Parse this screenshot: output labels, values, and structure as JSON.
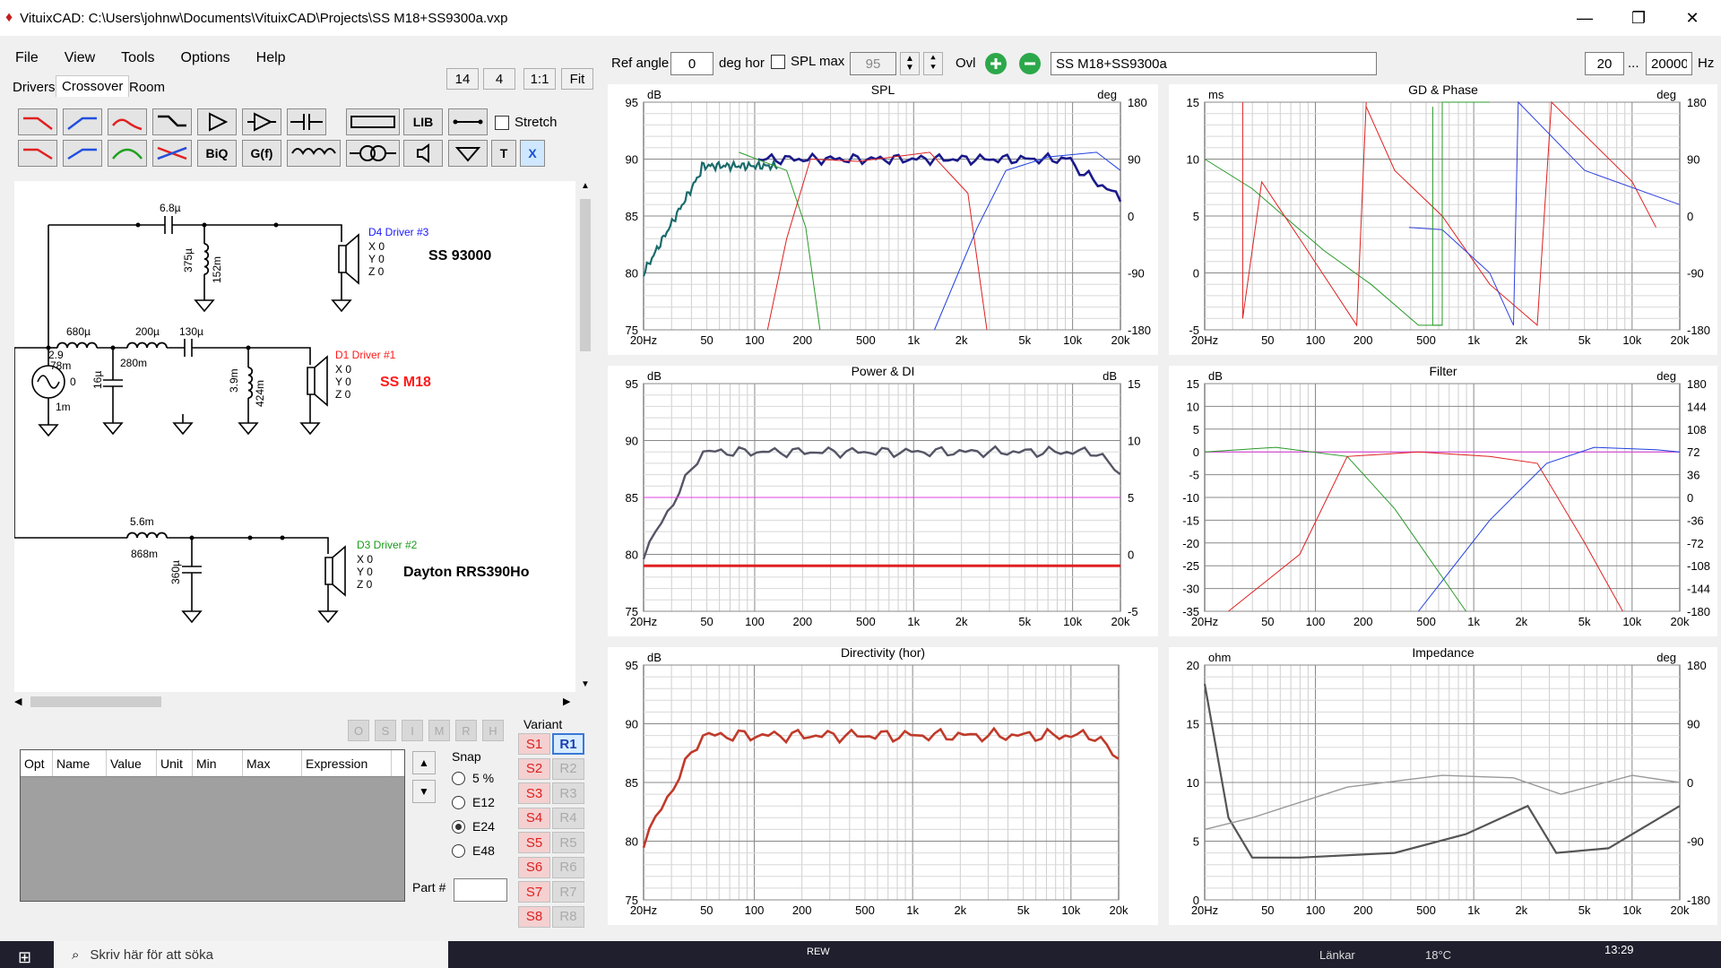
{
  "window": {
    "title": "VituixCAD: C:\\Users\\johnw\\Documents\\VituixCAD\\Projects\\SS M18+SS9300a.vxp"
  },
  "menu": [
    "File",
    "View",
    "Tools",
    "Options",
    "Help"
  ],
  "tabs": [
    "Drivers",
    "Crossover",
    "Room"
  ],
  "zoom_buttons": [
    "14",
    "4",
    "1:1",
    "Fit"
  ],
  "toolbar": {
    "lib": "LIB",
    "biq": "BiQ",
    "gf": "G(f)",
    "t": "T",
    "x": "X",
    "stretch": "Stretch"
  },
  "topbar": {
    "ref_angle_label": "Ref angle",
    "ref_angle": "0",
    "deg_hor": "deg hor",
    "spl_max_label": "SPL max",
    "spl_max": "95",
    "ovl": "Ovl",
    "project": "SS M18+SS9300a",
    "f_min": "20",
    "dots": "...",
    "f_max": "20000",
    "hz": "Hz"
  },
  "schematic": {
    "drivers": [
      {
        "id": "D4 Driver #3",
        "name": "SS 93000",
        "color": "#1a1aff",
        "x": "X 0",
        "y": "Y 0",
        "z": "Z 0"
      },
      {
        "id": "D1 Driver #1",
        "name": "SS M18",
        "color": "#ff1a1a",
        "x": "X 0",
        "y": "Y 0",
        "z": "Z 0"
      },
      {
        "id": "D3 Driver #2",
        "name": "Dayton RRS390Ho",
        "color": "#1a9a1a",
        "x": "X 0",
        "y": "Y 0",
        "z": "Z 0"
      }
    ],
    "labels": {
      "c1": "6.8µ",
      "l1": "375µ",
      "r1": "152m",
      "l2": "680µ",
      "l3": "200µ",
      "r3": "280m",
      "c2": "130µ",
      "l4": "3.9m",
      "r4": "424m",
      "r2": "78m",
      "c3": "16µ",
      "rs": "2.9",
      "gen0": "0",
      "gen1": "1m",
      "l5": "5.6m",
      "r5": "868m",
      "c4": "360µ"
    }
  },
  "param_table": {
    "headers": [
      "Opt",
      "Name",
      "Value",
      "Unit",
      "Min",
      "Max",
      "Expression"
    ]
  },
  "osir": [
    "O",
    "S",
    "I",
    "M",
    "R",
    "H"
  ],
  "snap": {
    "label": "Snap",
    "options": [
      "5 %",
      "E12",
      "E24",
      "E48"
    ],
    "selected": "E24"
  },
  "part_label": "Part #",
  "variant": {
    "label": "Variant",
    "s": [
      "S1",
      "S2",
      "S3",
      "S4",
      "S5",
      "S6",
      "S7",
      "S8"
    ],
    "r": [
      "R1",
      "R2",
      "R3",
      "R4",
      "R5",
      "R6",
      "R7",
      "R8"
    ]
  },
  "charts": {
    "spl": {
      "title": "SPL",
      "yunit": "dB",
      "y2unit": "deg",
      "yticks": [
        "95",
        "90",
        "85",
        "80",
        "75"
      ],
      "y2ticks": [
        "180",
        "90",
        "0",
        "-90",
        "-180"
      ]
    },
    "gd": {
      "title": "GD & Phase",
      "yunit": "ms",
      "y2unit": "deg",
      "yticks": [
        "15",
        "10",
        "5",
        "0",
        "-5"
      ],
      "y2ticks": [
        "180",
        "90",
        "0",
        "-90",
        "-180"
      ]
    },
    "power": {
      "title": "Power & DI",
      "yunit": "dB",
      "y2unit": "dB",
      "yticks": [
        "95",
        "90",
        "85",
        "80",
        "75"
      ],
      "y2ticks": [
        "15",
        "10",
        "5",
        "0",
        "-5"
      ]
    },
    "filter": {
      "title": "Filter",
      "yunit": "dB",
      "y2unit": "deg",
      "yticks": [
        "15",
        "10",
        "5",
        "0",
        "-5",
        "-10",
        "-15",
        "-20",
        "-25",
        "-30",
        "-35"
      ],
      "y2ticks": [
        "180",
        "144",
        "108",
        "72",
        "36",
        "0",
        "-36",
        "-72",
        "-108",
        "-144",
        "-180"
      ]
    },
    "dir": {
      "title": "Directivity (hor)",
      "yunit": "dB",
      "y2unit": "",
      "yticks": [
        "95",
        "90",
        "85",
        "80",
        "75"
      ],
      "y2ticks": []
    },
    "imp": {
      "title": "Impedance",
      "yunit": "ohm",
      "y2unit": "deg",
      "yticks": [
        "20",
        "15",
        "10",
        "5",
        "0"
      ],
      "y2ticks": [
        "180",
        "90",
        "0",
        "-90",
        "-180"
      ]
    },
    "xticks": [
      "20Hz",
      "50",
      "100",
      "200",
      "500",
      "1k",
      "2k",
      "5k",
      "10k",
      "20k"
    ]
  },
  "taskbar": {
    "search": "Skriv här för att söka",
    "links": "Länkar",
    "temp": "18°C",
    "time": "13:29",
    "rew": "REW"
  }
}
